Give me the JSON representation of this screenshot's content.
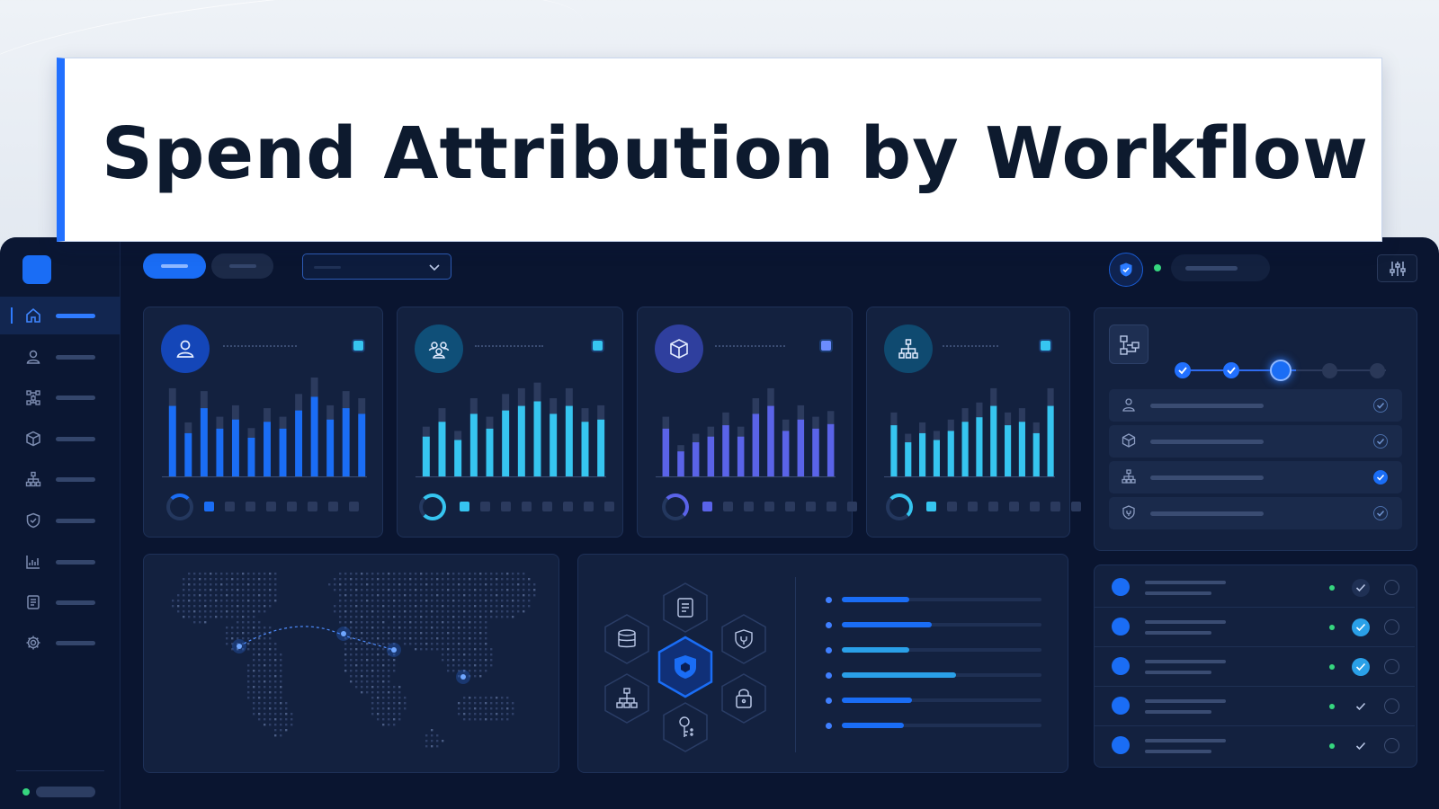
{
  "title": "Spend Attribution by Workflow",
  "colors": {
    "accent": "#1a6df5",
    "bg_dark": "#0a1530",
    "card": "#13213f",
    "cyan": "#36c5f0",
    "indigo": "#5a63e8",
    "green": "#36d67f"
  },
  "sidebar": {
    "items": [
      {
        "icon": "home-icon",
        "active": true
      },
      {
        "icon": "user-icon",
        "active": false
      },
      {
        "icon": "network-icon",
        "active": false
      },
      {
        "icon": "cube-icon",
        "active": false
      },
      {
        "icon": "hierarchy-icon",
        "active": false
      },
      {
        "icon": "shield-icon",
        "active": false
      },
      {
        "icon": "report-chart-icon",
        "active": false
      },
      {
        "icon": "document-icon",
        "active": false
      },
      {
        "icon": "settings-gear-icon",
        "active": false
      }
    ]
  },
  "kpi_cards": [
    {
      "icon": "user-icon",
      "accent": "#1a6df5",
      "values": [
        0.62,
        0.38,
        0.6,
        0.42,
        0.5,
        0.34,
        0.48,
        0.42,
        0.58,
        0.7,
        0.5,
        0.6,
        0.55
      ]
    },
    {
      "icon": "team-icon",
      "accent": "#36c5f0",
      "values": [
        0.35,
        0.48,
        0.32,
        0.55,
        0.42,
        0.58,
        0.62,
        0.66,
        0.55,
        0.62,
        0.48,
        0.5
      ]
    },
    {
      "icon": "cube-icon",
      "accent": "#5a63e8",
      "values": [
        0.42,
        0.22,
        0.3,
        0.35,
        0.45,
        0.35,
        0.55,
        0.62,
        0.4,
        0.5,
        0.42,
        0.46
      ]
    },
    {
      "icon": "hierarchy-icon",
      "accent": "#36c5f0",
      "values": [
        0.45,
        0.3,
        0.38,
        0.32,
        0.4,
        0.48,
        0.52,
        0.62,
        0.45,
        0.48,
        0.38,
        0.62
      ]
    }
  ],
  "hbars": [
    0.34,
    0.45,
    0.34,
    0.57,
    0.35,
    0.31
  ],
  "workflow": {
    "step_icon": "flowchart-icon",
    "rows": [
      {
        "icon": "user-icon",
        "checked": false
      },
      {
        "icon": "cube-icon",
        "checked": false
      },
      {
        "icon": "hierarchy-icon",
        "checked": true
      },
      {
        "icon": "shield-icon",
        "checked": false
      }
    ]
  },
  "tasks": [
    {
      "check": "outline"
    },
    {
      "check": "filled"
    },
    {
      "check": "filled"
    },
    {
      "check": "plain"
    },
    {
      "check": "plain"
    }
  ]
}
